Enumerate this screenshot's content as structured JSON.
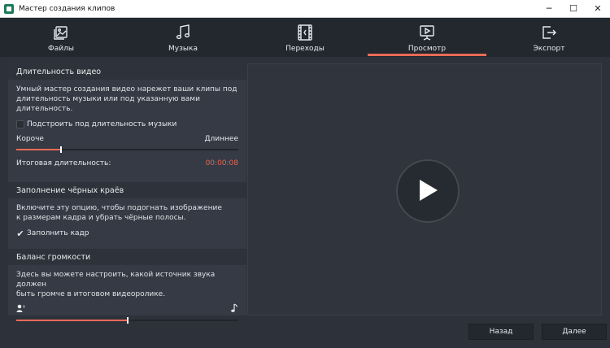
{
  "window": {
    "title": "Мастер создания клипов",
    "minimize": "─",
    "maximize": "☐",
    "close": "✕"
  },
  "tabs": [
    {
      "label": "Файлы",
      "icon": "files-icon"
    },
    {
      "label": "Музыка",
      "icon": "music-icon"
    },
    {
      "label": "Переходы",
      "icon": "transitions-icon"
    },
    {
      "label": "Просмотр",
      "icon": "preview-icon",
      "active": true
    },
    {
      "label": "Экспорт",
      "icon": "export-icon"
    }
  ],
  "duration": {
    "header": "Длительность видео",
    "description_line1": "Умный мастер создания видео нарежет ваши клипы под",
    "description_line2": "длительность музыки или под указанную вами длительность.",
    "fit_music_label": "Подстроить под длительность музыки",
    "fit_music_checked": false,
    "shorter_label": "Короче",
    "longer_label": "Длиннее",
    "slider_fraction": 0.2,
    "total_label": "Итоговая длительность:",
    "total_value": "00:00:08"
  },
  "black_borders": {
    "header": "Заполнение чёрных краёв",
    "description_line1": "Включите эту опцию, чтобы подогнать изображение",
    "description_line2": "к размерам кадра и убрать чёрные полосы.",
    "fill_frame_label": "Заполнить кадр",
    "fill_frame_checked": true
  },
  "volume": {
    "header": "Баланс громкости",
    "description_line1": "Здесь вы можете настроить, какой источник звука должен",
    "description_line2": "быть громче в итоговом видеоролике.",
    "left_icon": "voice-icon",
    "right_icon": "music-note-icon",
    "slider_fraction": 0.5
  },
  "footer": {
    "back_label": "Назад",
    "next_label": "Далее"
  },
  "colors": {
    "accent": "#e86b55",
    "background": "#2c313a",
    "panel": "#353a44"
  }
}
